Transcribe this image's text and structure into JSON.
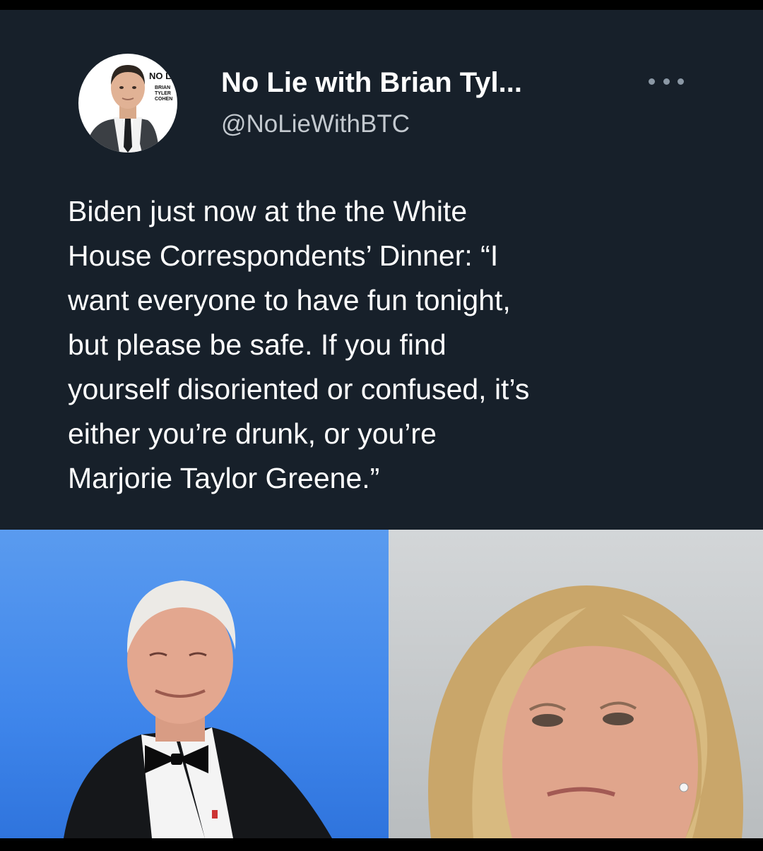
{
  "tweet": {
    "author": {
      "display_name": "No Lie with Brian Tyl...",
      "handle": "@NoLieWithBTC",
      "avatar_logo": "NO LIE",
      "avatar_logo_sub": "BRIAN TYLER COHEN"
    },
    "more_icon": "more-horizontal-icon",
    "text_lines": [
      "Biden just now at the the White",
      "House Correspondents’ Dinner: “I",
      "want everyone to have fun tonight,",
      "but please be safe. If you find",
      "yourself disoriented or confused, it’s",
      "either you’re drunk, or you’re",
      "Marjorie Taylor Greene.”"
    ]
  },
  "colors": {
    "card_background": "#17202a",
    "text_primary": "#ffffff",
    "text_secondary": "#c3c9cf"
  }
}
